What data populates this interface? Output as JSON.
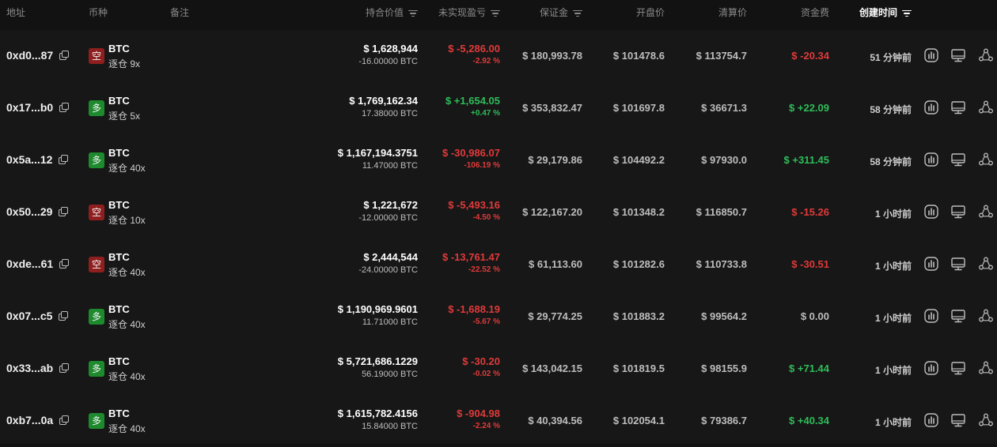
{
  "header": {
    "address": "地址",
    "coin": "币种",
    "note": "备注",
    "position_value": "持合价值",
    "unrealized_pnl": "未实现盈亏",
    "margin": "保证金",
    "open_price": "开盘价",
    "liq_price": "清算价",
    "funding_fee": "资金费",
    "created_time": "创建时间"
  },
  "icons": {
    "filter": "filter-icon",
    "copy": "copy-icon",
    "chart": "chart-icon",
    "monitor": "monitor-icon",
    "share": "share-icon"
  },
  "colors": {
    "red": "#e03a3a",
    "green": "#2ebd59",
    "short_badge": "#8f1f1f",
    "long_badge": "#1e8a2e"
  },
  "rows": [
    {
      "address": "0xd0...87",
      "side": "空",
      "side_type": "short",
      "coin": "BTC",
      "mode": "逐仓 9x",
      "value": "$ 1,628,944",
      "size": "-16.00000 BTC",
      "pnl": "$ -5,286.00",
      "pnl_pct": "-2.92 %",
      "pnl_color": "red",
      "margin": "$ 180,993.78",
      "open": "$ 101478.6",
      "liq": "$ 113754.7",
      "fee": "$ -20.34",
      "fee_color": "red",
      "time": "51 分钟前"
    },
    {
      "address": "0x17...b0",
      "side": "多",
      "side_type": "long",
      "coin": "BTC",
      "mode": "逐仓 5x",
      "value": "$ 1,769,162.34",
      "size": "17.38000 BTC",
      "pnl": "$ +1,654.05",
      "pnl_pct": "+0.47 %",
      "pnl_color": "green",
      "margin": "$ 353,832.47",
      "open": "$ 101697.8",
      "liq": "$ 36671.3",
      "fee": "$ +22.09",
      "fee_color": "green",
      "time": "58 分钟前"
    },
    {
      "address": "0x5a...12",
      "side": "多",
      "side_type": "long",
      "coin": "BTC",
      "mode": "逐仓 40x",
      "value": "$ 1,167,194.3751",
      "size": "11.47000 BTC",
      "pnl": "$ -30,986.07",
      "pnl_pct": "-106.19 %",
      "pnl_color": "red",
      "margin": "$ 29,179.86",
      "open": "$ 104492.2",
      "liq": "$ 97930.0",
      "fee": "$ +311.45",
      "fee_color": "green",
      "time": "58 分钟前"
    },
    {
      "address": "0x50...29",
      "side": "空",
      "side_type": "short",
      "coin": "BTC",
      "mode": "逐仓 10x",
      "value": "$ 1,221,672",
      "size": "-12.00000 BTC",
      "pnl": "$ -5,493.16",
      "pnl_pct": "-4.50 %",
      "pnl_color": "red",
      "margin": "$ 122,167.20",
      "open": "$ 101348.2",
      "liq": "$ 116850.7",
      "fee": "$ -15.26",
      "fee_color": "red",
      "time": "1 小时前"
    },
    {
      "address": "0xde...61",
      "side": "空",
      "side_type": "short",
      "coin": "BTC",
      "mode": "逐仓 40x",
      "value": "$ 2,444,544",
      "size": "-24.00000 BTC",
      "pnl": "$ -13,761.47",
      "pnl_pct": "-22.52 %",
      "pnl_color": "red",
      "margin": "$ 61,113.60",
      "open": "$ 101282.6",
      "liq": "$ 110733.8",
      "fee": "$ -30.51",
      "fee_color": "red",
      "time": "1 小时前"
    },
    {
      "address": "0x07...c5",
      "side": "多",
      "side_type": "long",
      "coin": "BTC",
      "mode": "逐仓 40x",
      "value": "$ 1,190,969.9601",
      "size": "11.71000 BTC",
      "pnl": "$ -1,688.19",
      "pnl_pct": "-5.67 %",
      "pnl_color": "red",
      "margin": "$ 29,774.25",
      "open": "$ 101883.2",
      "liq": "$ 99564.2",
      "fee": "$ 0.00",
      "fee_color": "muted",
      "time": "1 小时前"
    },
    {
      "address": "0x33...ab",
      "side": "多",
      "side_type": "long",
      "coin": "BTC",
      "mode": "逐仓 40x",
      "value": "$ 5,721,686.1229",
      "size": "56.19000 BTC",
      "pnl": "$ -30.20",
      "pnl_pct": "-0.02 %",
      "pnl_color": "red",
      "margin": "$ 143,042.15",
      "open": "$ 101819.5",
      "liq": "$ 98155.9",
      "fee": "$ +71.44",
      "fee_color": "green",
      "time": "1 小时前"
    },
    {
      "address": "0xb7...0a",
      "side": "多",
      "side_type": "long",
      "coin": "BTC",
      "mode": "逐仓 40x",
      "value": "$ 1,615,782.4156",
      "size": "15.84000 BTC",
      "pnl": "$ -904.98",
      "pnl_pct": "-2.24 %",
      "pnl_color": "red",
      "margin": "$ 40,394.56",
      "open": "$ 102054.1",
      "liq": "$ 79386.7",
      "fee": "$ +40.34",
      "fee_color": "green",
      "time": "1 小时前"
    }
  ]
}
